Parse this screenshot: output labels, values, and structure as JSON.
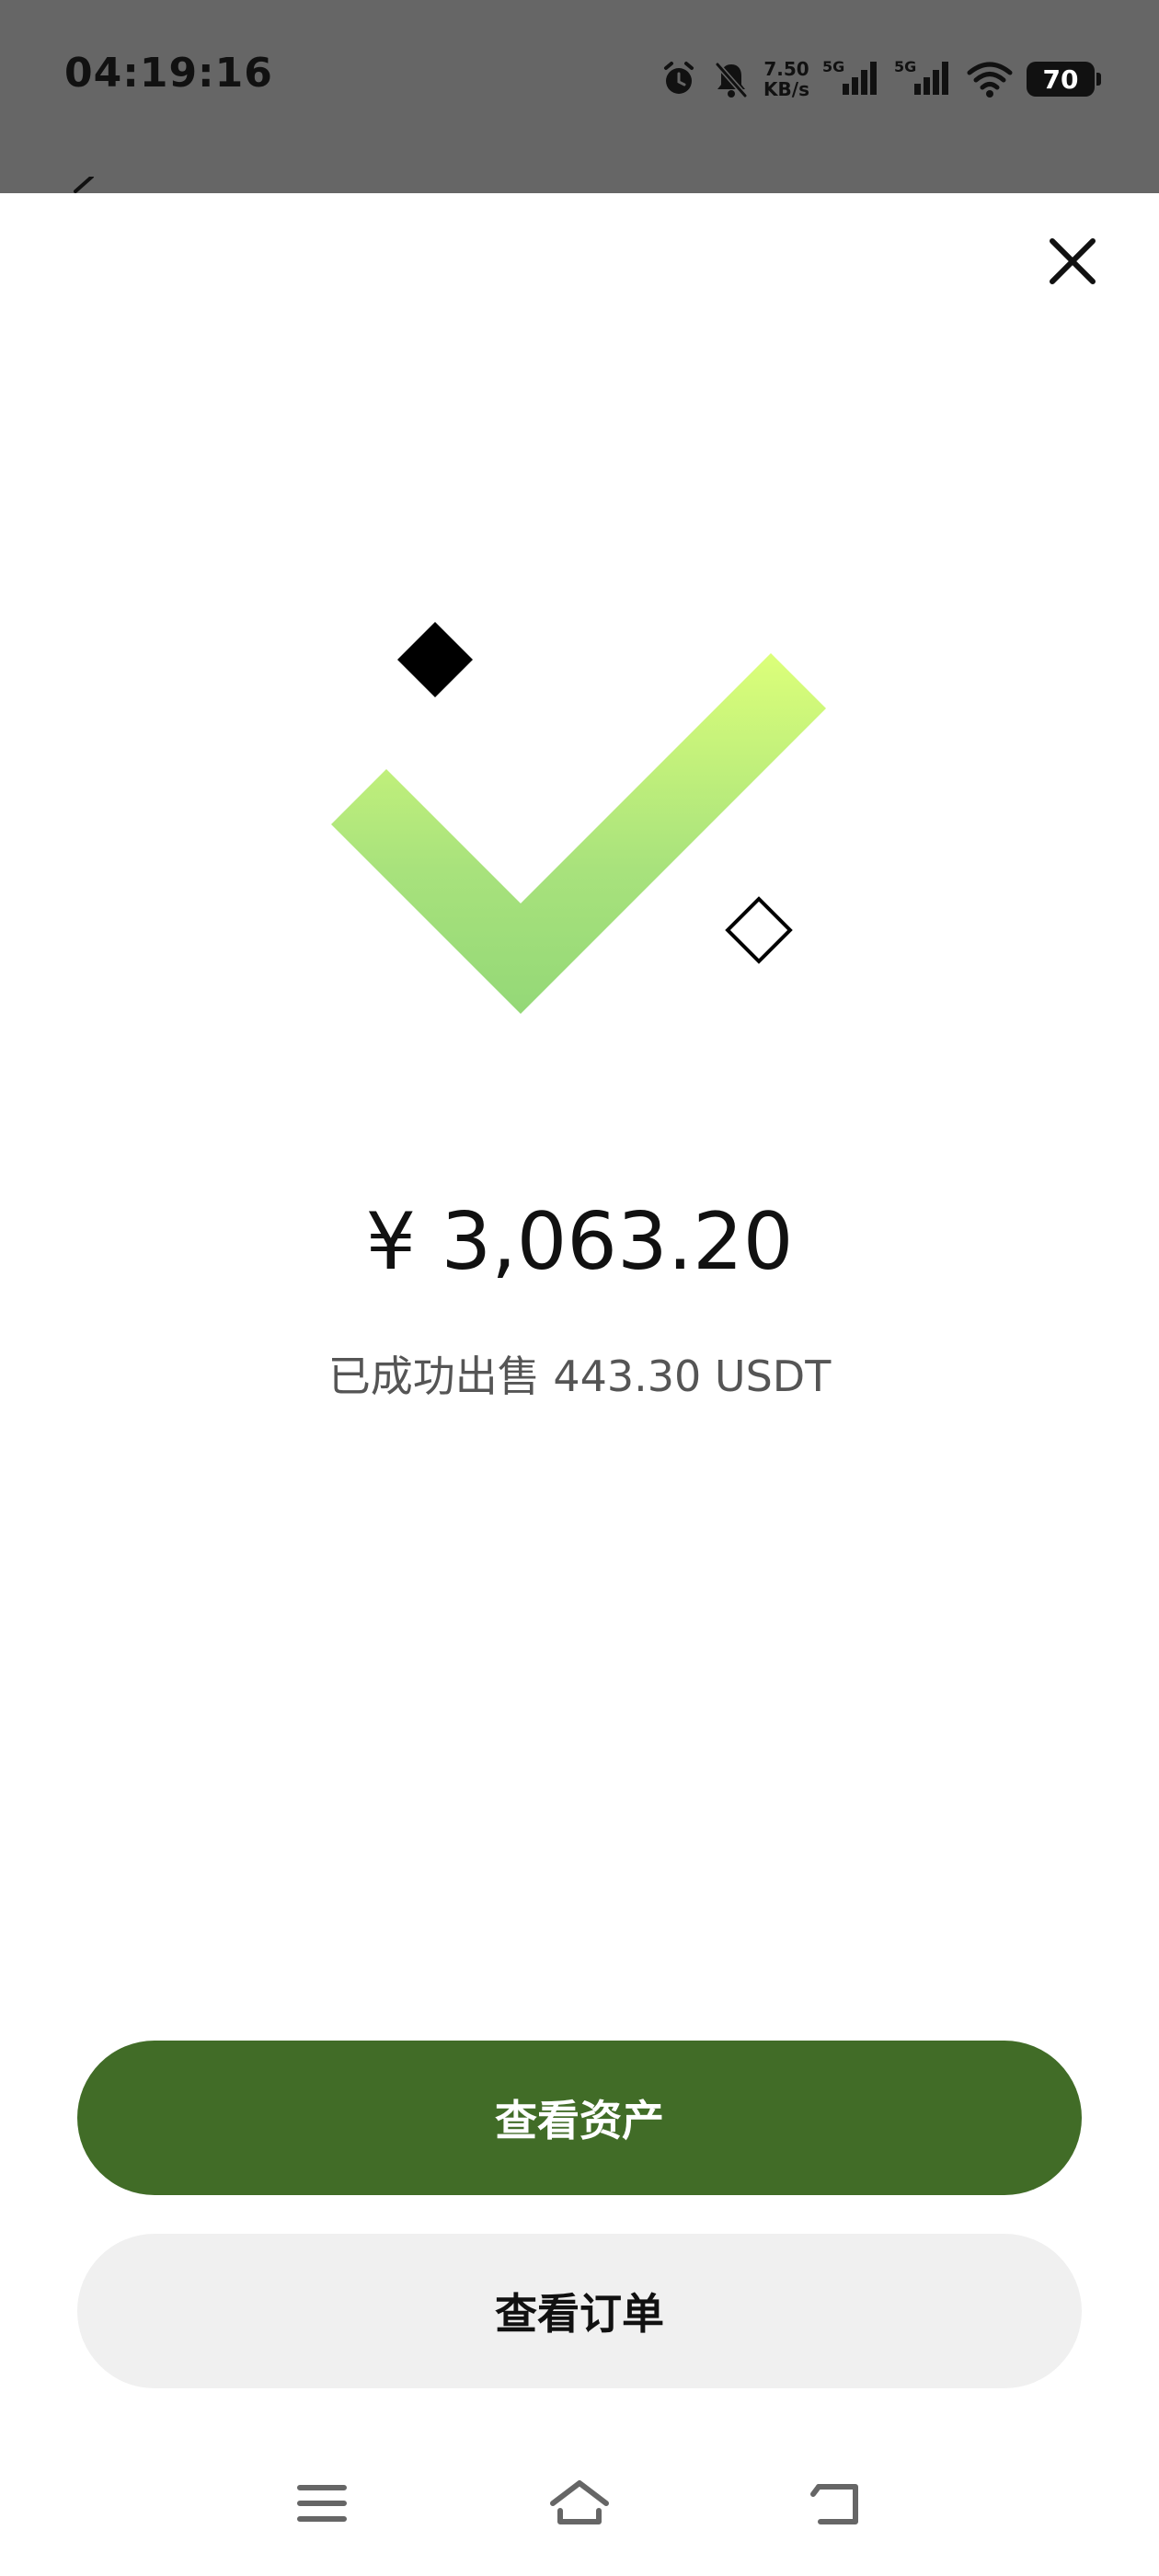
{
  "status_bar": {
    "time": "04:19:16",
    "net_speed_value": "7.50",
    "net_speed_unit": "KB/s",
    "sim1_label": "5G",
    "sim2_label": "5G",
    "battery": "70"
  },
  "result": {
    "amount": "¥ 3,063.20",
    "message": "已成功出售 443.30 USDT"
  },
  "actions": {
    "view_assets": "查看资产",
    "view_orders": "查看订单"
  },
  "colors": {
    "primary_button": "#416c27",
    "secondary_button": "#f0f0f0",
    "check_gradient_top": "#dcff7a",
    "check_gradient_bottom": "#94d877",
    "status_bar_bg": "#666666"
  },
  "icons": {
    "close": "close-icon",
    "menu": "menu-icon",
    "home": "home-icon",
    "back": "back-icon"
  }
}
